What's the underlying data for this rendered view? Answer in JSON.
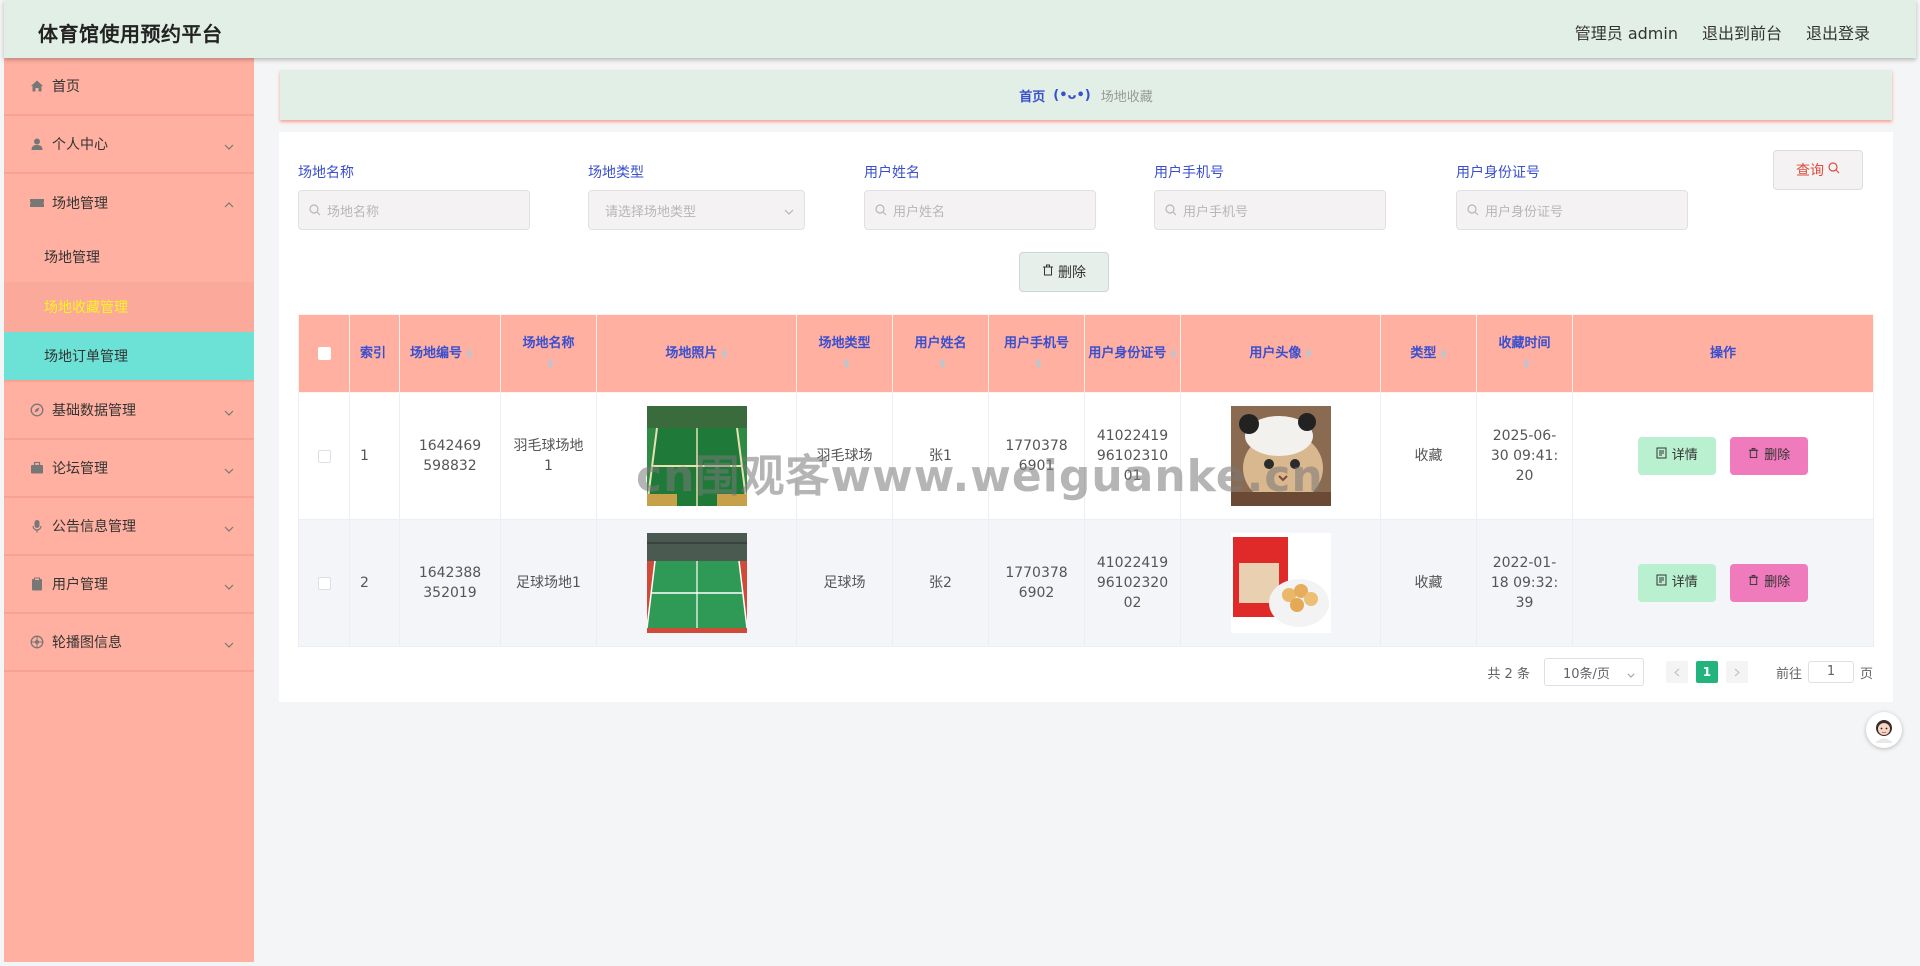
{
  "app": {
    "title": "体育馆使用预约平台"
  },
  "header": {
    "user_label": "管理员 admin",
    "front_link": "退出到前台",
    "logout": "退出登录"
  },
  "sidebar": {
    "items": [
      {
        "label": "首页",
        "icon": "home-icon"
      },
      {
        "label": "个人中心",
        "icon": "user-icon"
      },
      {
        "label": "场地管理",
        "icon": "ticket-icon",
        "expanded": true,
        "children": [
          "场地管理",
          "场地收藏管理",
          "场地订单管理"
        ]
      },
      {
        "label": "基础数据管理",
        "icon": "compass-icon"
      },
      {
        "label": "论坛管理",
        "icon": "briefcase-icon"
      },
      {
        "label": "公告信息管理",
        "icon": "microphone-icon"
      },
      {
        "label": "用户管理",
        "icon": "clipboard-icon"
      },
      {
        "label": "轮播图信息",
        "icon": "aperture-icon"
      }
    ]
  },
  "breadcrumb": {
    "home": "首页",
    "emoji": "(•ᴗ•)",
    "current": "场地收藏"
  },
  "filters": {
    "venue_name": {
      "label": "场地名称",
      "placeholder": "场地名称"
    },
    "venue_type": {
      "label": "场地类型",
      "placeholder": "请选择场地类型"
    },
    "user_name": {
      "label": "用户姓名",
      "placeholder": "用户姓名"
    },
    "user_phone": {
      "label": "用户手机号",
      "placeholder": "用户手机号"
    },
    "user_id_card": {
      "label": "用户身份证号",
      "placeholder": "用户身份证号"
    },
    "query_button": "查询",
    "delete_button": "删除"
  },
  "table": {
    "headers": [
      "索引",
      "场地编号",
      "场地名称",
      "场地照片",
      "场地类型",
      "用户姓名",
      "用户手机号",
      "用户身份证号",
      "用户头像",
      "类型",
      "收藏时间",
      "操作"
    ],
    "rows": [
      {
        "index": "1",
        "code": "1642469598832",
        "name": "羽毛球场地1",
        "type": "羽毛球场",
        "user": "张1",
        "phone": "17703786901",
        "id_card": "410224199610231001",
        "fav_type": "收藏",
        "time": "2025-06-30 09:41:20"
      },
      {
        "index": "2",
        "code": "1642388352019",
        "name": "足球场地1",
        "type": "足球场",
        "user": "张2",
        "phone": "17703786902",
        "id_card": "410224199610232002",
        "fav_type": "收藏",
        "time": "2022-01-18 09:32:39"
      }
    ],
    "detail_button": "详情",
    "delete_button": "删除"
  },
  "pagination": {
    "total": "共 2 条",
    "page_size": "10条/页",
    "current_page": "1",
    "goto_prefix": "前往",
    "goto_value": "1",
    "goto_suffix": "页"
  },
  "watermark": "cn围观客www.weiguanke.cn",
  "colors": {
    "sidebar": "#ffb0a0",
    "header": "#e2efe6",
    "active_menu": "#6ce2d6",
    "accent_blue": "#3a4fcf",
    "pager_active": "#23b47e"
  }
}
